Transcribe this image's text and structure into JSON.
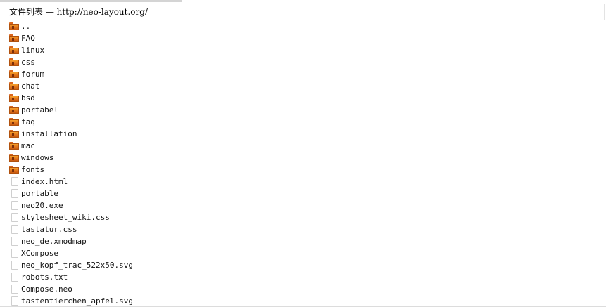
{
  "header": {
    "title": "文件列表 — http://neo-layout.org/"
  },
  "entries": [
    {
      "name": "..",
      "type": "folder",
      "icon": "folder-icon"
    },
    {
      "name": "FAQ",
      "type": "folder",
      "icon": "folder-icon"
    },
    {
      "name": "linux",
      "type": "folder",
      "icon": "folder-icon"
    },
    {
      "name": "css",
      "type": "folder",
      "icon": "folder-icon"
    },
    {
      "name": "forum",
      "type": "folder",
      "icon": "folder-icon"
    },
    {
      "name": "chat",
      "type": "folder",
      "icon": "folder-icon"
    },
    {
      "name": "bsd",
      "type": "folder",
      "icon": "folder-icon"
    },
    {
      "name": "portabel",
      "type": "folder",
      "icon": "folder-icon"
    },
    {
      "name": "faq",
      "type": "folder",
      "icon": "folder-icon"
    },
    {
      "name": "installation",
      "type": "folder",
      "icon": "folder-icon"
    },
    {
      "name": "mac",
      "type": "folder",
      "icon": "folder-icon"
    },
    {
      "name": "windows",
      "type": "folder",
      "icon": "folder-icon"
    },
    {
      "name": "fonts",
      "type": "folder",
      "icon": "folder-icon"
    },
    {
      "name": "index.html",
      "type": "file",
      "icon": "file-icon"
    },
    {
      "name": "portable",
      "type": "file",
      "icon": "file-icon"
    },
    {
      "name": "neo20.exe",
      "type": "file",
      "icon": "file-icon"
    },
    {
      "name": "stylesheet_wiki.css",
      "type": "file",
      "icon": "file-icon"
    },
    {
      "name": "tastatur.css",
      "type": "file",
      "icon": "file-icon"
    },
    {
      "name": "neo_de.xmodmap",
      "type": "file",
      "icon": "file-icon"
    },
    {
      "name": "XCompose",
      "type": "file",
      "icon": "file-icon"
    },
    {
      "name": "neo_kopf_trac_522x50.svg",
      "type": "file",
      "icon": "file-icon"
    },
    {
      "name": "robots.txt",
      "type": "file",
      "icon": "file-icon"
    },
    {
      "name": "Compose.neo",
      "type": "file",
      "icon": "file-icon"
    },
    {
      "name": "tastentierchen_apfel.svg",
      "type": "file",
      "icon": "file-icon"
    }
  ]
}
